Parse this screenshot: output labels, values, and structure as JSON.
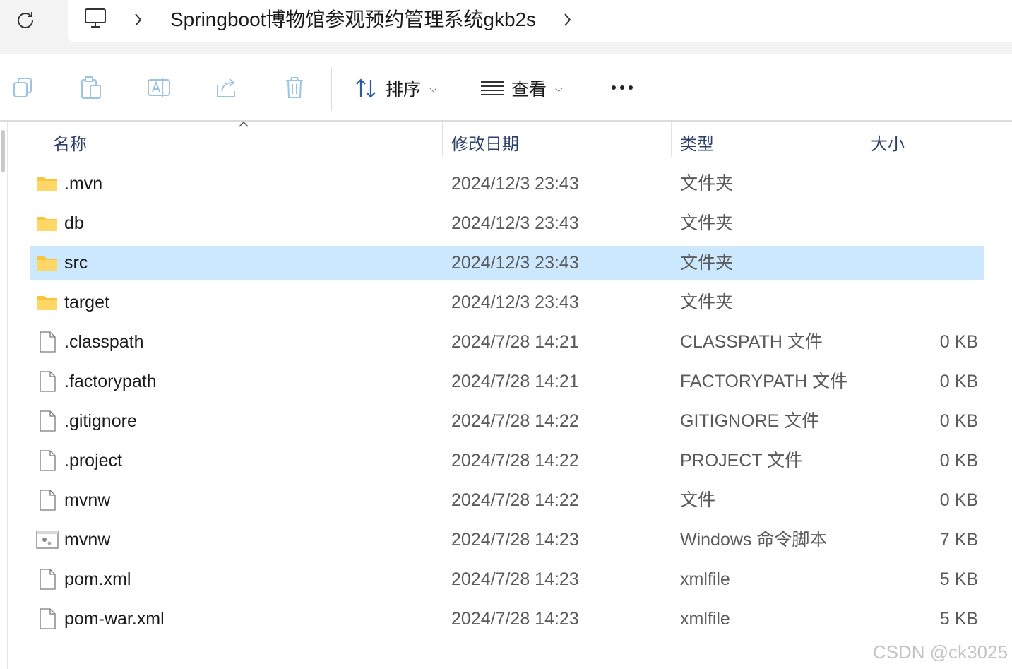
{
  "breadcrumb": {
    "path": "Springboot博物馆参观预约管理系统gkb2s"
  },
  "toolbar": {
    "sort_label": "排序",
    "view_label": "查看"
  },
  "columns": {
    "name": "名称",
    "modified": "修改日期",
    "type": "类型",
    "size": "大小"
  },
  "files": [
    {
      "name": ".mvn",
      "modified": "2024/12/3 23:43",
      "type": "文件夹",
      "size": "",
      "icon": "folder-icon",
      "selected": false
    },
    {
      "name": "db",
      "modified": "2024/12/3 23:43",
      "type": "文件夹",
      "size": "",
      "icon": "folder-icon",
      "selected": false
    },
    {
      "name": "src",
      "modified": "2024/12/3 23:43",
      "type": "文件夹",
      "size": "",
      "icon": "folder-icon",
      "selected": true
    },
    {
      "name": "target",
      "modified": "2024/12/3 23:43",
      "type": "文件夹",
      "size": "",
      "icon": "folder-icon",
      "selected": false
    },
    {
      "name": ".classpath",
      "modified": "2024/7/28 14:21",
      "type": "CLASSPATH 文件",
      "size": "0 KB",
      "icon": "file-icon",
      "selected": false
    },
    {
      "name": ".factorypath",
      "modified": "2024/7/28 14:21",
      "type": "FACTORYPATH 文件",
      "size": "0 KB",
      "icon": "file-icon",
      "selected": false
    },
    {
      "name": ".gitignore",
      "modified": "2024/7/28 14:22",
      "type": "GITIGNORE 文件",
      "size": "0 KB",
      "icon": "file-icon",
      "selected": false
    },
    {
      "name": ".project",
      "modified": "2024/7/28 14:22",
      "type": "PROJECT 文件",
      "size": "0 KB",
      "icon": "file-icon",
      "selected": false
    },
    {
      "name": "mvnw",
      "modified": "2024/7/28 14:22",
      "type": "文件",
      "size": "0 KB",
      "icon": "file-icon",
      "selected": false
    },
    {
      "name": "mvnw",
      "modified": "2024/7/28 14:23",
      "type": "Windows 命令脚本",
      "size": "7 KB",
      "icon": "script-icon",
      "selected": false
    },
    {
      "name": "pom.xml",
      "modified": "2024/7/28 14:23",
      "type": "xmlfile",
      "size": "5 KB",
      "icon": "file-icon",
      "selected": false
    },
    {
      "name": "pom-war.xml",
      "modified": "2024/7/28 14:23",
      "type": "xmlfile",
      "size": "5 KB",
      "icon": "file-icon",
      "selected": false
    }
  ],
  "watermark": "CSDN @ck3025",
  "colors": {
    "selected_row": "#cce8ff",
    "folder": "#f8c541",
    "header_text": "#2c3e6a"
  }
}
